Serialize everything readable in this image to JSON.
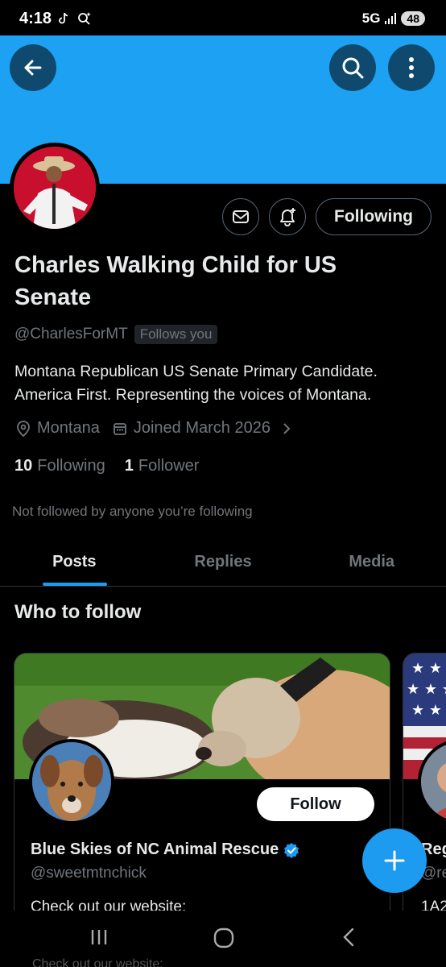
{
  "status_bar": {
    "time": "4:18",
    "network": "5G",
    "battery": "48"
  },
  "colors": {
    "banner": "#1da1f2",
    "accent": "#1d9bf0",
    "background": "#000000",
    "muted": "#71767b"
  },
  "header": {
    "back_icon": "arrow-left-icon",
    "search_icon": "search-icon",
    "more_icon": "more-vertical-icon"
  },
  "profile": {
    "name": "Charles Walking Child for US Senate",
    "handle": "@CharlesForMT",
    "follows_you": "Follows you",
    "bio": "Montana Republican US Senate Primary Candidate. America First. Representing the voices of Montana.",
    "location": "Montana",
    "joined": "Joined March 2026",
    "following_count": "10",
    "following_label": "Following",
    "followers_count": "1",
    "followers_label": "Follower",
    "not_followed": "Not followed by anyone you’re following",
    "following_button": "Following"
  },
  "tabs": [
    {
      "label": "Posts",
      "active": true
    },
    {
      "label": "Replies",
      "active": false
    },
    {
      "label": "Media",
      "active": false
    }
  ],
  "who_to_follow": {
    "title": "Who to follow",
    "cards": [
      {
        "name": "Blue Skies of NC Animal Rescue",
        "verified": true,
        "handle": "@sweetmtnchick",
        "bio": "Check out our website:",
        "button": "Follow"
      },
      {
        "name": "Reg",
        "handle": "@re",
        "bio": "1A2"
      }
    ]
  },
  "fab": {
    "icon": "plus-icon"
  },
  "nav": {
    "recents_icon": "recents-icon",
    "home_icon": "home-icon",
    "back_icon": "back-icon"
  },
  "ghost_text": "Check out our website:"
}
